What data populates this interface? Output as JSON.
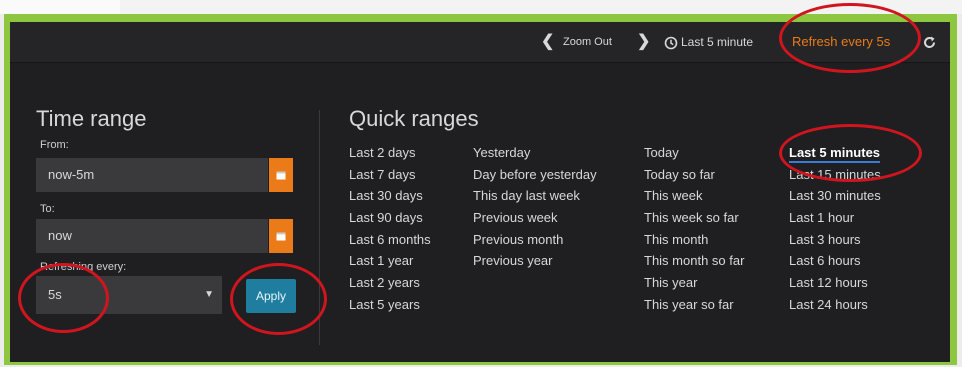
{
  "toolbar": {
    "prev_icon": "chevron-left-icon",
    "zoom_out": "Zoom Out",
    "next_icon": "chevron-right-icon",
    "clock_icon": "clock-icon",
    "time_label": "Last 5 minute",
    "refresh_label": "Refresh every 5s",
    "refresh_icon": "refresh-icon"
  },
  "time_range": {
    "title": "Time range",
    "from_label": "From:",
    "from_value": "now-5m",
    "to_label": "To:",
    "to_value": "now",
    "refreshing_label": "Refreshing every:",
    "refresh_value": "5s",
    "apply_label": "Apply",
    "calendar_icon": "calendar-icon"
  },
  "quick_ranges": {
    "title": "Quick ranges",
    "columns": [
      [
        "Last 2 days",
        "Last 7 days",
        "Last 30 days",
        "Last 90 days",
        "Last 6 months",
        "Last 1 year",
        "Last 2 years",
        "Last 5 years"
      ],
      [
        "Yesterday",
        "Day before yesterday",
        "This day last week",
        "Previous week",
        "Previous month",
        "Previous year"
      ],
      [
        "Today",
        "Today so far",
        "This week",
        "This week so far",
        "This month",
        "This month so far",
        "This year",
        "This year so far"
      ],
      [
        "Last 5 minutes",
        "Last 15 minutes",
        "Last 30 minutes",
        "Last 1 hour",
        "Last 3 hours",
        "Last 6 hours",
        "Last 12 hours",
        "Last 24 hours"
      ]
    ],
    "active": "Last 5 minutes"
  },
  "colors": {
    "frame": "#8dc63f",
    "panel": "#1f1f21",
    "accent_orange": "#eb7b18",
    "apply_blue": "#1f7ea0",
    "annotation_red": "#d1151f"
  }
}
